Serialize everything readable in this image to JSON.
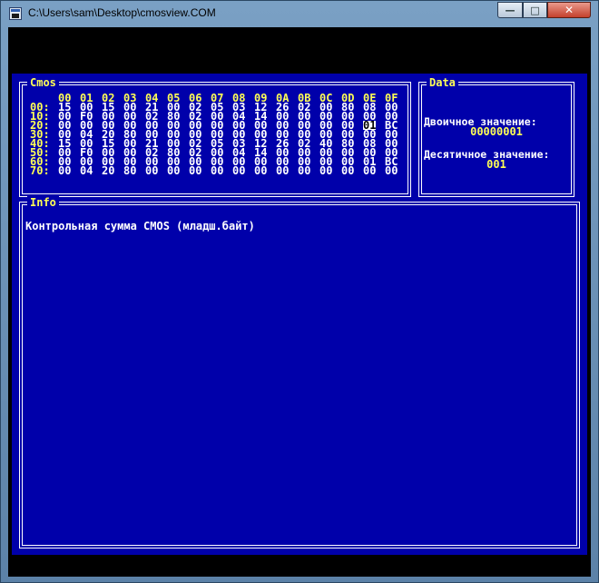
{
  "window": {
    "title": "C:\\Users\\sam\\Desktop\\cmosview.COM"
  },
  "titlebar_buttons": {
    "minimize": "—",
    "maximize": "□",
    "close": "✕"
  },
  "cmos": {
    "title": "Cmos",
    "header": [
      "00",
      "01",
      "02",
      "03",
      "04",
      "05",
      "06",
      "07",
      "08",
      "09",
      "0A",
      "0B",
      "0C",
      "0D",
      "0E",
      "0F"
    ],
    "rows": [
      {
        "label": "00:",
        "cells": [
          "15",
          "00",
          "15",
          "00",
          "21",
          "00",
          "02",
          "05",
          "03",
          "12",
          "26",
          "02",
          "00",
          "80",
          "08",
          "00"
        ]
      },
      {
        "label": "10:",
        "cells": [
          "00",
          "F0",
          "00",
          "00",
          "02",
          "80",
          "02",
          "00",
          "04",
          "14",
          "00",
          "00",
          "00",
          "00",
          "00",
          "00"
        ]
      },
      {
        "label": "20:",
        "cells": [
          "00",
          "00",
          "00",
          "00",
          "00",
          "00",
          "00",
          "00",
          "00",
          "00",
          "00",
          "00",
          "00",
          "00",
          "01",
          "BC"
        ]
      },
      {
        "label": "30:",
        "cells": [
          "00",
          "04",
          "20",
          "80",
          "00",
          "00",
          "00",
          "00",
          "00",
          "00",
          "00",
          "00",
          "00",
          "00",
          "00",
          "00"
        ]
      },
      {
        "label": "40:",
        "cells": [
          "15",
          "00",
          "15",
          "00",
          "21",
          "00",
          "02",
          "05",
          "03",
          "12",
          "26",
          "02",
          "40",
          "80",
          "08",
          "00"
        ]
      },
      {
        "label": "50:",
        "cells": [
          "00",
          "F0",
          "00",
          "00",
          "02",
          "80",
          "02",
          "00",
          "04",
          "14",
          "00",
          "00",
          "00",
          "00",
          "00",
          "00"
        ]
      },
      {
        "label": "60:",
        "cells": [
          "00",
          "00",
          "00",
          "00",
          "00",
          "00",
          "00",
          "00",
          "00",
          "00",
          "00",
          "00",
          "00",
          "00",
          "01",
          "BC"
        ]
      },
      {
        "label": "70:",
        "cells": [
          "00",
          "04",
          "20",
          "80",
          "00",
          "00",
          "00",
          "00",
          "00",
          "00",
          "00",
          "00",
          "00",
          "00",
          "00",
          "00"
        ]
      }
    ],
    "selected": {
      "row": 2,
      "col": 14
    }
  },
  "data": {
    "title": "Data",
    "binary_label": "Двоичное значение:",
    "binary_value": "00000001",
    "decimal_label": "Десятичное значение:",
    "decimal_value": "001"
  },
  "info": {
    "title": "Info",
    "text": "Контрольная сумма CMOS (младш.байт)"
  },
  "colors": {
    "background": "#0000aa",
    "highlight": "#ffff55",
    "text": "#ffffff",
    "selection_bg": "#ffffff",
    "selection_fg": "#000000"
  }
}
